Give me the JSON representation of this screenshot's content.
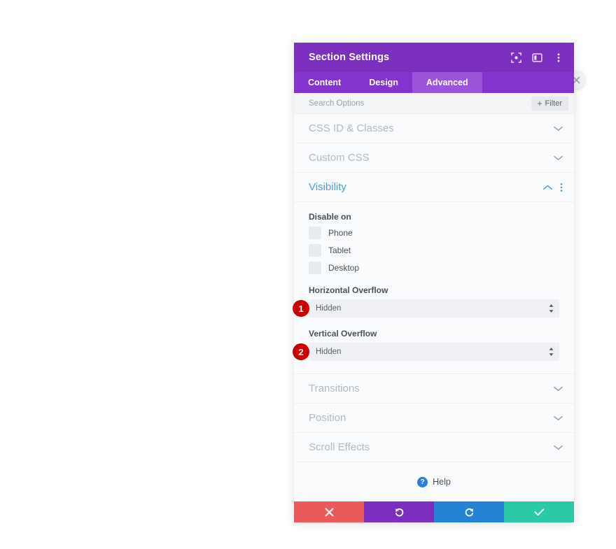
{
  "panel": {
    "title": "Section Settings",
    "header_icons": [
      {
        "name": "focus-target-icon",
        "label": "Focus"
      },
      {
        "name": "panel-layout-icon",
        "label": "Layout"
      },
      {
        "name": "kebab-menu-icon",
        "label": "More options"
      }
    ],
    "tabs": [
      {
        "label": "Content",
        "active": false
      },
      {
        "label": "Design",
        "active": false
      },
      {
        "label": "Advanced",
        "active": true
      }
    ],
    "search": {
      "placeholder": "Search Options",
      "value": ""
    },
    "filter_button": {
      "plus": "+",
      "label": "Filter"
    },
    "sections": [
      {
        "title": "CSS ID & Classes",
        "open": false
      },
      {
        "title": "Custom CSS",
        "open": false
      },
      {
        "title": "Visibility",
        "open": true
      },
      {
        "title": "Transitions",
        "open": false
      },
      {
        "title": "Position",
        "open": false
      },
      {
        "title": "Scroll Effects",
        "open": false
      }
    ],
    "visibility": {
      "disable_on_label": "Disable on",
      "devices": [
        {
          "label": "Phone",
          "checked": false
        },
        {
          "label": "Tablet",
          "checked": false
        },
        {
          "label": "Desktop",
          "checked": false
        }
      ],
      "horizontal_overflow": {
        "label": "Horizontal Overflow",
        "value": "Hidden",
        "badge": "1"
      },
      "vertical_overflow": {
        "label": "Vertical Overflow",
        "value": "Hidden",
        "badge": "2"
      }
    },
    "help": {
      "icon_glyph": "?",
      "label": "Help"
    },
    "footer_buttons": [
      {
        "name": "cancel-button",
        "glyph": "close-x-icon"
      },
      {
        "name": "undo-button",
        "glyph": "undo-arrow-icon"
      },
      {
        "name": "redo-button",
        "glyph": "redo-arrow-icon"
      },
      {
        "name": "save-button",
        "glyph": "checkmark-icon"
      }
    ],
    "close_button": {
      "glyph": "close-x-icon"
    }
  },
  "colors": {
    "header_purple": "#7b2fbe",
    "tab_bar_purple": "#8334cc",
    "tab_active_purple": "#9a54da",
    "accent_blue": "#4c9fd0",
    "badge_red": "#cc0000",
    "cancel_red": "#eb5a5a",
    "redo_blue": "#2683d4",
    "save_teal": "#2cc9a6",
    "help_blue": "#2e7cd6"
  }
}
